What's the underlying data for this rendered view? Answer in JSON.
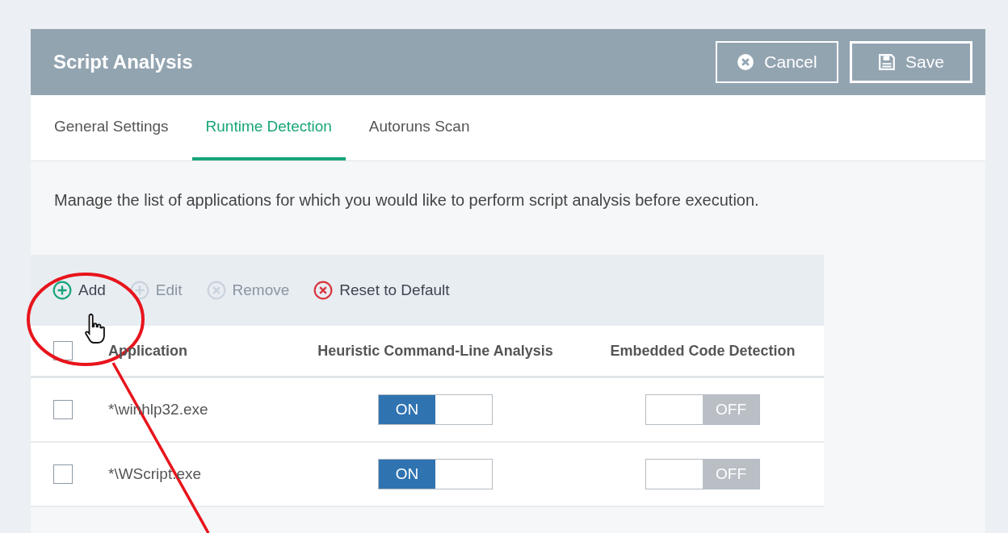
{
  "header": {
    "title": "Script Analysis",
    "buttons": [
      {
        "label": "Cancel",
        "kind": "cancel"
      },
      {
        "label": "Save",
        "kind": "save"
      }
    ]
  },
  "tabs": [
    {
      "label": "General Settings",
      "selected": false
    },
    {
      "label": "Runtime Detection",
      "selected": true
    },
    {
      "label": "Autoruns Scan",
      "selected": false
    }
  ],
  "description": "Manage the list of applications for which you would like to perform script analysis before execution.",
  "toolbar": [
    {
      "label": "Add",
      "kind": "add",
      "disabled": false
    },
    {
      "label": "Edit",
      "kind": "add",
      "disabled": true
    },
    {
      "label": "Remove",
      "kind": "remove",
      "disabled": true
    },
    {
      "label": "Reset to Default",
      "kind": "remove",
      "disabled": false
    }
  ],
  "table": {
    "header_checked": false,
    "columns": [
      "Application",
      "Heuristic Command-Line Analysis",
      "Embedded Code Detection"
    ],
    "rows": [
      {
        "checked": false,
        "application": "*\\winhlp32.exe",
        "heuristic": {
          "on": true,
          "label": "ON"
        },
        "embedded": {
          "on": false,
          "label": "OFF"
        }
      },
      {
        "checked": false,
        "application": "*\\WScript.exe",
        "heuristic": {
          "on": true,
          "label": "ON"
        },
        "embedded": {
          "on": false,
          "label": "OFF"
        }
      }
    ]
  }
}
